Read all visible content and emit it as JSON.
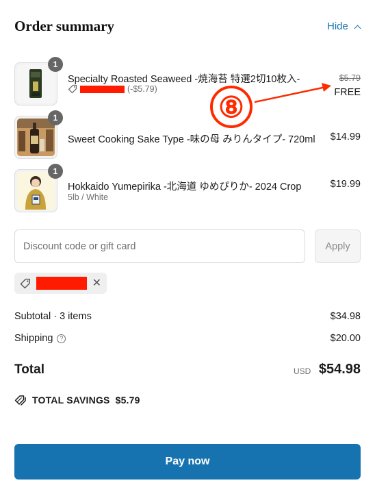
{
  "header": {
    "title": "Order summary",
    "hide_label": "Hide"
  },
  "items": [
    {
      "name": "Specialty Roasted Seaweed -焼海苔 特選2切10枚入-",
      "quantity": "1",
      "original_price": "$5.79",
      "price": "FREE",
      "discount": "(-$5.79)"
    },
    {
      "name": "Sweet Cooking Sake Type -味の母 みりんタイプ- 720ml",
      "quantity": "1",
      "price": "$14.99"
    },
    {
      "name": "Hokkaido Yumepirika -北海道 ゆめぴりか- 2024 Crop",
      "quantity": "1",
      "variant": "5lb / White",
      "price": "$19.99"
    }
  ],
  "annotation": {
    "marker": "⑧",
    "color": "#ff2a00"
  },
  "discount": {
    "placeholder": "Discount code or gift card",
    "apply_label": "Apply",
    "redacted_color": "#ff1a00"
  },
  "summary": {
    "subtotal_label": "Subtotal · 3 items",
    "subtotal_value": "$34.98",
    "shipping_label": "Shipping",
    "shipping_value": "$20.00",
    "total_label": "Total",
    "currency": "USD",
    "total_value": "$54.98",
    "savings_label": "TOTAL SAVINGS",
    "savings_value": "$5.79"
  },
  "pay_label": "Pay now",
  "colors": {
    "accent": "#1773b0",
    "text": "#1a1a1a",
    "muted": "#707070",
    "badge": "#666666"
  }
}
